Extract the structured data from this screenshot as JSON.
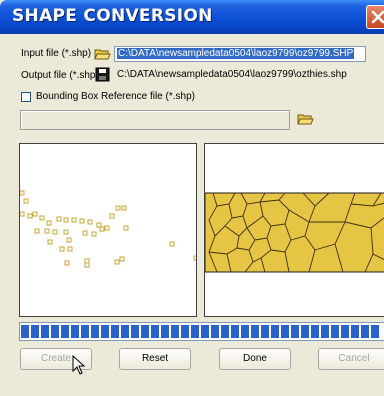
{
  "window": {
    "title": "SHAPE CONVERSION"
  },
  "input": {
    "label": "Input file (*.shp)",
    "path": "C:\\DATA\\newsampledata0504\\laoz9799\\oz9799.SHP",
    "icon": "folder-open-icon"
  },
  "output": {
    "label": "Output file (*.shp)",
    "path": "C:\\DATA\\newsampledata0504\\laoz9799\\ozthies.shp",
    "icon": "floppy-disk-icon"
  },
  "bounding": {
    "label": "Bounding Box Reference  file (*.shp)",
    "checked": false,
    "path": "",
    "icon": "folder-open-icon"
  },
  "points_preview": {
    "point_color": "#c8a430"
  },
  "polygon_preview": {
    "fill_color": "#e6c444"
  },
  "progress": {
    "fraction": 1.0,
    "color": "#2a62cc"
  },
  "buttons": {
    "create": "Create",
    "reset": "Reset",
    "done": "Done",
    "cancel": "Cancel"
  }
}
